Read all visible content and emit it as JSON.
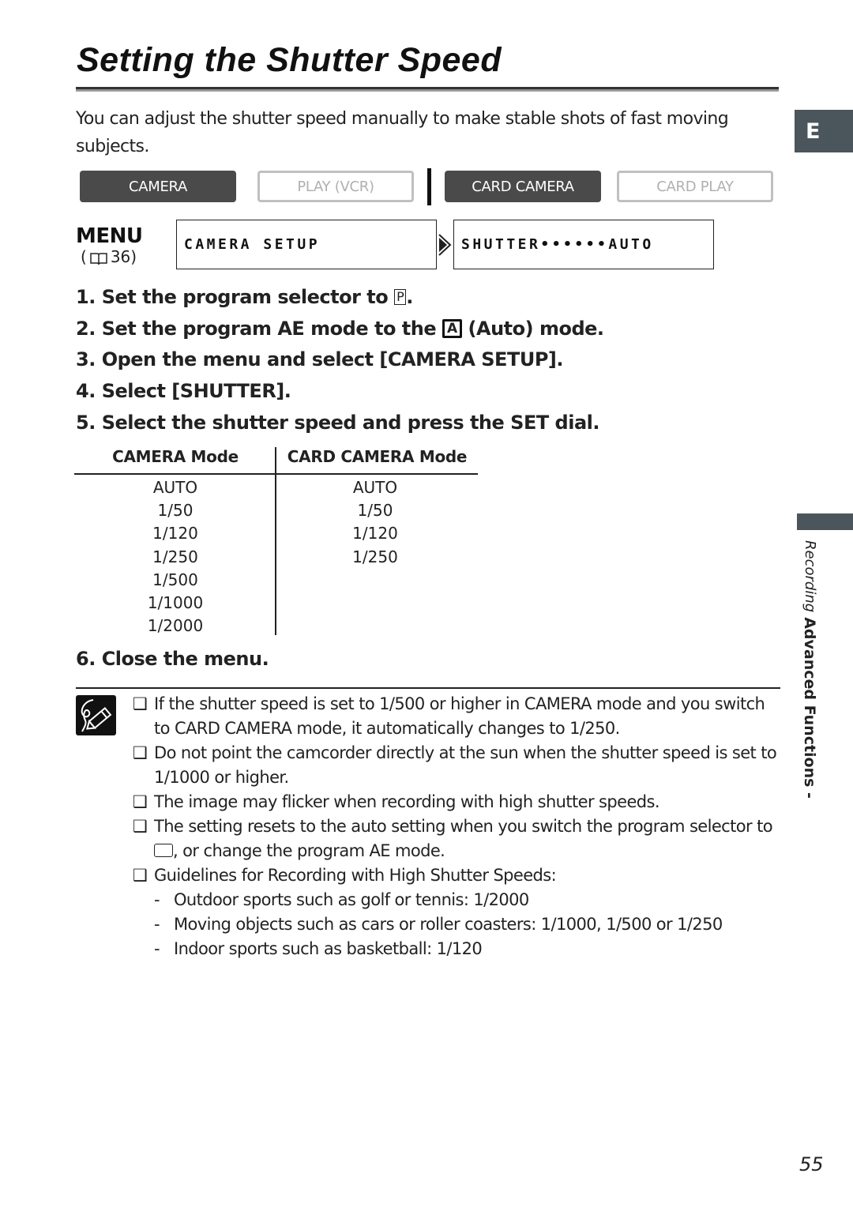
{
  "page": {
    "title": "Setting the Shutter Speed",
    "intro": "You can adjust the shutter speed manually to make stable shots of fast moving subjects.",
    "language_tab": "E",
    "section_side_label": {
      "main": "Advanced Functions -",
      "sub": "Recording"
    },
    "page_number": "55"
  },
  "modes": [
    {
      "label": "CAMERA",
      "active": true
    },
    {
      "label": "PLAY (VCR)",
      "active": false
    },
    {
      "label": "CARD CAMERA",
      "active": true
    },
    {
      "label": "CARD PLAY",
      "active": false
    }
  ],
  "menu": {
    "label": "MENU",
    "ref_open": "(",
    "ref_page": "36)",
    "ref_icon": "book-icon",
    "path": [
      "CAMERA SETUP",
      "SHUTTER••••••AUTO"
    ]
  },
  "steps": [
    {
      "num": "1.",
      "before": "Set the program selector to",
      "glyph": "P",
      "after": "."
    },
    {
      "num": "2.",
      "before": "Set the program AE mode to the",
      "glyph": "A",
      "after": "(Auto) mode."
    },
    {
      "num": "3.",
      "text": "Open the menu and select [CAMERA SETUP]."
    },
    {
      "num": "4.",
      "text": "Select [SHUTTER]."
    },
    {
      "num": "5.",
      "text": "Select the shutter speed and press the SET dial."
    },
    {
      "num": "6.",
      "text": "Close the menu."
    }
  ],
  "shutter_table": {
    "headers": [
      "CAMERA Mode",
      "CARD CAMERA Mode"
    ],
    "camera_mode": [
      "AUTO",
      "1/50",
      "1/120",
      "1/250",
      "1/500",
      "1/1000",
      "1/2000"
    ],
    "card_camera_mode": [
      "AUTO",
      "1/50",
      "1/120",
      "1/250"
    ]
  },
  "notes": {
    "icon": "pencil-note-icon",
    "bullet": "❑",
    "items": [
      "If the shutter speed is set to 1/500 or higher in CAMERA mode and you switch to CARD CAMERA mode, it automatically changes to 1/250.",
      "Do not point the camcorder directly at the sun when the shutter speed is set to 1/1000 or higher.",
      "The image may flicker when recording with high shutter speeds.",
      {
        "before": "The setting resets to the auto setting when you switch the program selector to",
        "after": ", or change the program AE mode."
      },
      "Guidelines for Recording with High Shutter Speeds:"
    ],
    "guidelines": [
      "Outdoor sports such as golf or tennis: 1/2000",
      "Moving objects such as cars or roller coasters: 1/1000, 1/500 or 1/250",
      "Indoor sports such as basketball: 1/120"
    ]
  }
}
